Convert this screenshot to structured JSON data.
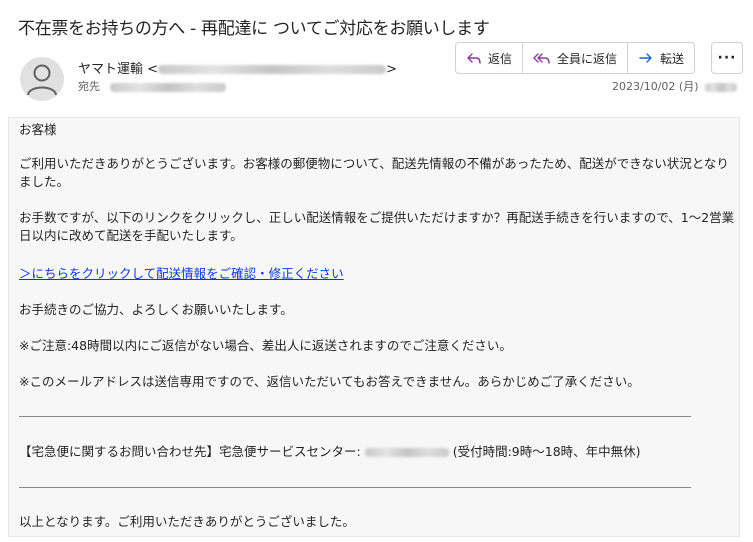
{
  "email": {
    "subject": "不在票をお持ちの方へ - 再配達に  ついてご対応をお願いします",
    "sender_name": "ヤマト運輸",
    "to_label": "宛先",
    "date": "2023/10/02 (月)"
  },
  "actions": {
    "reply": "返信",
    "reply_all": "全員に返信",
    "forward": "転送",
    "more": "···"
  },
  "body": {
    "greeting": "お客様",
    "para1": "ご利用いただきありがとうございます。お客様の郵便物について、配送先情報の不備があったため、配送ができない状況となりました。",
    "para2": "お手数ですが、以下のリンクをクリックし、正しい配送情報をご提供いただけますか？再配送手続きを行いますので、1〜2営業日以内に改めて配送を手配いたします。",
    "link": "＞にちらをクリックして配送情報をご確認・修正ください",
    "para3": "お手続きのご協力、よろしくお願いいたします。",
    "notice1": "※ご注意:48時間以内にご返信がない場合、差出人に返送されますのでご注意ください。",
    "notice2": "※このメールアドレスは送信専用ですので、返信いただいてもお答えできません。あらかじめご了承ください。",
    "contact_prefix": "【宅急便に関するお問い合わせ先】宅急便サービスセンター:",
    "contact_suffix": "(受付時間:9時～18時、年中無休)",
    "closing": "以上となります。ご利用いただきありがとうございました。"
  }
}
